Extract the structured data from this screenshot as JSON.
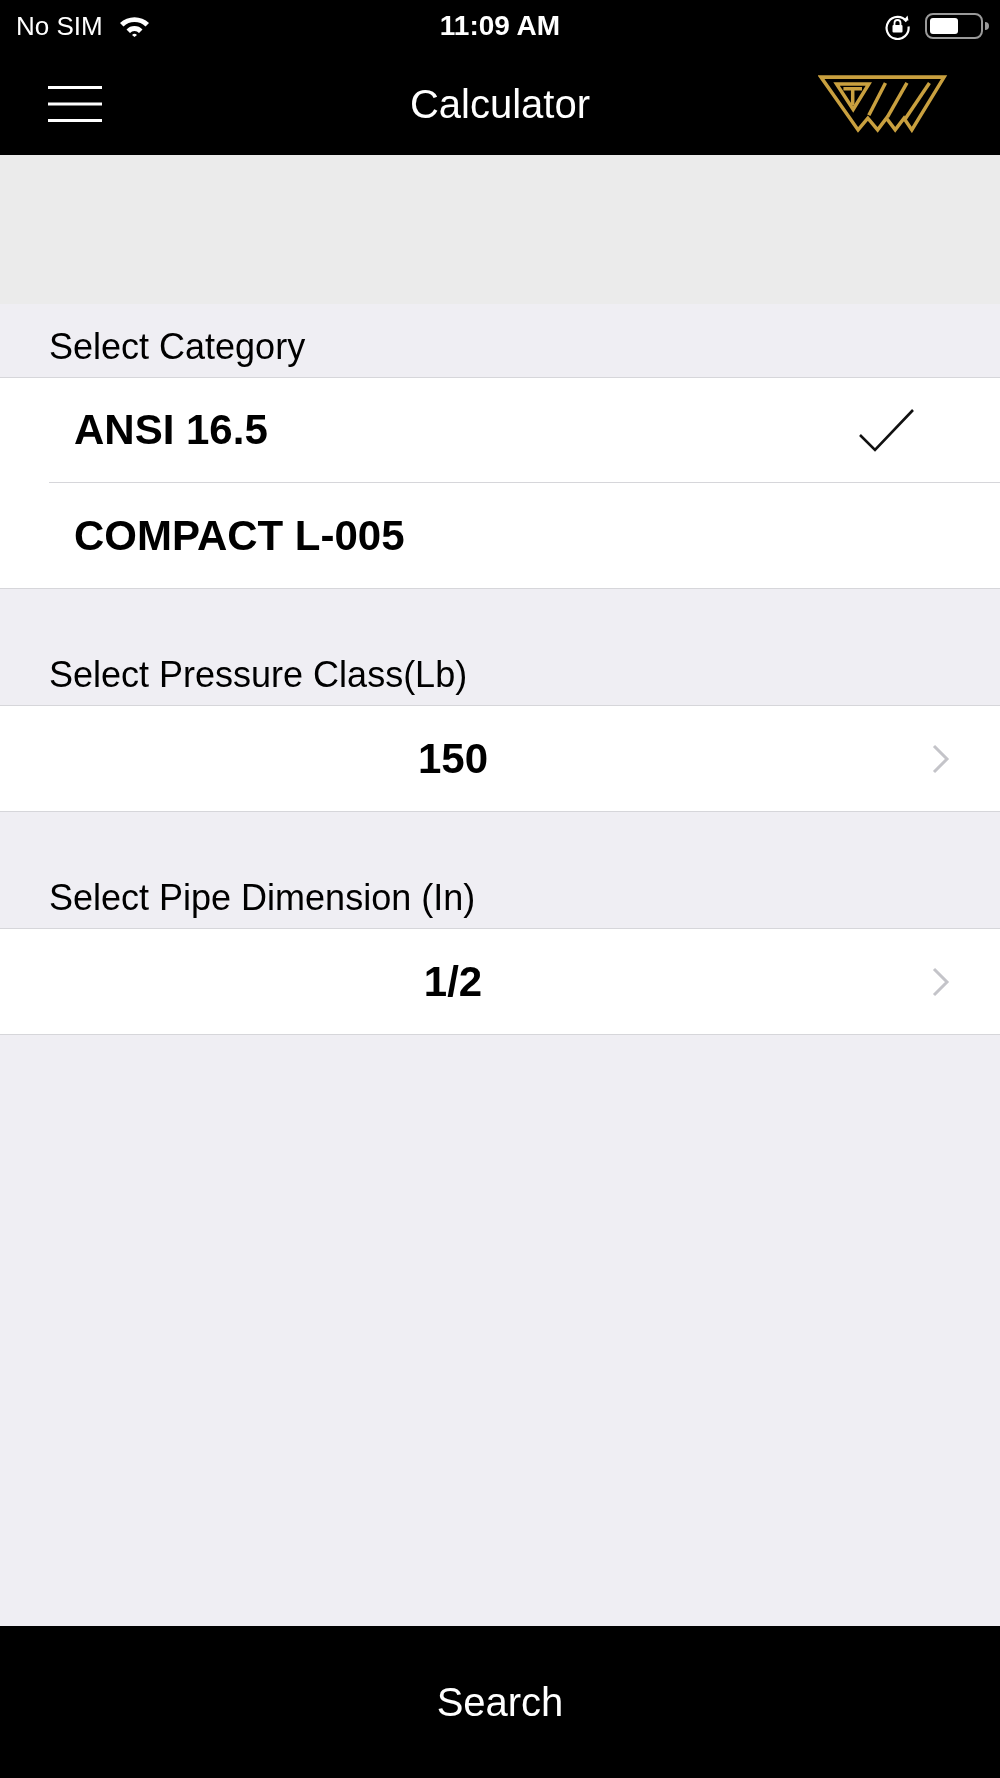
{
  "status_bar": {
    "carrier": "No SIM",
    "time": "11:09 AM"
  },
  "nav_bar": {
    "title": "Calculator"
  },
  "sections": [
    {
      "header": "Select Category",
      "kind": "checklist",
      "items": [
        {
          "label": "ANSI 16.5",
          "selected": true
        },
        {
          "label": "COMPACT L-005",
          "selected": false
        }
      ]
    },
    {
      "header": "Select Pressure Class(Lb)",
      "kind": "picker",
      "value": "150"
    },
    {
      "header": "Select Pipe Dimension (In)",
      "kind": "picker",
      "value": "1/2"
    }
  ],
  "search_button": {
    "label": "Search"
  }
}
